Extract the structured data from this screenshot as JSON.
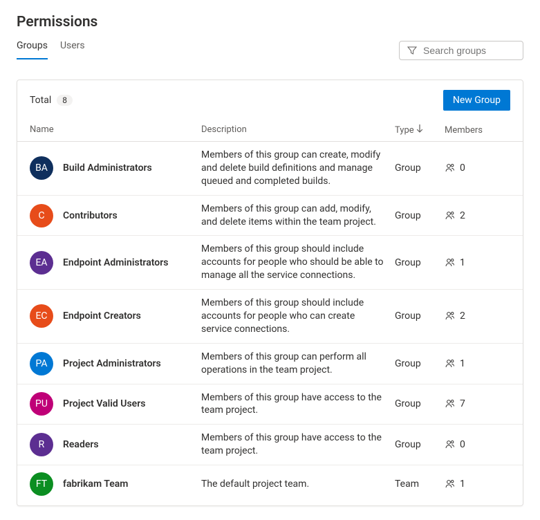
{
  "title": "Permissions",
  "tabs": {
    "groups": "Groups",
    "users": "Users",
    "active": "groups"
  },
  "search": {
    "placeholder": "Search groups"
  },
  "totalLabel": "Total",
  "totalCount": "8",
  "newGroupLabel": "New Group",
  "columns": {
    "name": "Name",
    "description": "Description",
    "type": "Type",
    "members": "Members"
  },
  "rows": [
    {
      "initials": "BA",
      "color": "#0f2f5d",
      "name": "Build Administrators",
      "description": "Members of this group can create, modify and delete build definitions and manage queued and completed builds.",
      "type": "Group",
      "members": "0"
    },
    {
      "initials": "C",
      "color": "#e74c1a",
      "name": "Contributors",
      "description": "Members of this group can add, modify, and delete items within the team project.",
      "type": "Group",
      "members": "2"
    },
    {
      "initials": "EA",
      "color": "#5c2e91",
      "name": "Endpoint Administrators",
      "description": "Members of this group should include accounts for people who should be able to manage all the service connections.",
      "type": "Group",
      "members": "1"
    },
    {
      "initials": "EC",
      "color": "#e74c1a",
      "name": "Endpoint Creators",
      "description": "Members of this group should include accounts for people who can create service connections.",
      "type": "Group",
      "members": "2"
    },
    {
      "initials": "PA",
      "color": "#0078d4",
      "name": "Project Administrators",
      "description": "Members of this group can perform all operations in the team project.",
      "type": "Group",
      "members": "1"
    },
    {
      "initials": "PU",
      "color": "#bf0077",
      "name": "Project Valid Users",
      "description": "Members of this group have access to the team project.",
      "type": "Group",
      "members": "7"
    },
    {
      "initials": "R",
      "color": "#5c2e91",
      "name": "Readers",
      "description": "Members of this group have access to the team project.",
      "type": "Group",
      "members": "0"
    },
    {
      "initials": "FT",
      "color": "#0b8e21",
      "name": "fabrikam Team",
      "description": "The default project team.",
      "type": "Team",
      "members": "1"
    }
  ]
}
